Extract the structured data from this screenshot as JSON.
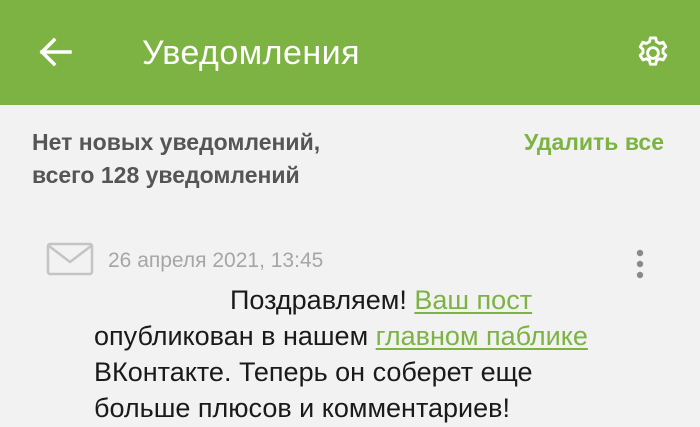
{
  "header": {
    "title": "Уведомления",
    "back_icon": "arrow-left-icon",
    "settings_icon": "gear-icon",
    "background_color": "#7cb342"
  },
  "summary": {
    "line1": "Нет новых уведомлений,",
    "line2": "всего 128 уведомлений",
    "delete_all_label": "Удалить все"
  },
  "notifications": [
    {
      "icon": "envelope-icon",
      "timestamp": "26 апреля 2021, 13:45",
      "menu_icon": "more-vertical-icon",
      "message": {
        "part1": "Поздравляем! ",
        "link1": "Ваш пост",
        "part2": "опубликован в нашем ",
        "link2": "главном паблике",
        "part3": "ВКонтакте. Теперь он соберет еще",
        "part4": "больше плюсов и комментариев!"
      }
    }
  ],
  "colors": {
    "accent": "#7cb342",
    "text_primary": "#1a1a1a",
    "text_secondary": "#555555",
    "text_muted": "#a6a6a6",
    "background": "#f2f2f2"
  }
}
